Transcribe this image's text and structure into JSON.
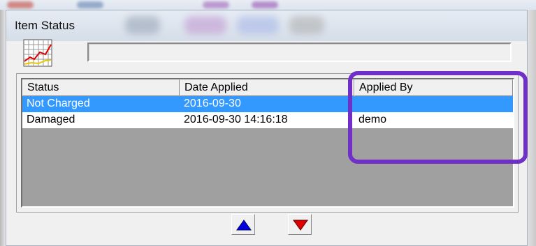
{
  "window": {
    "title": "Item Status"
  },
  "status_field": {
    "value": ""
  },
  "list": {
    "columns": [
      {
        "label": "Status"
      },
      {
        "label": "Date Applied"
      },
      {
        "label": "Applied By"
      }
    ],
    "rows": [
      {
        "status": "Not Charged",
        "date_applied": "2016-09-30",
        "applied_by": "",
        "selected": true
      },
      {
        "status": "Damaged",
        "date_applied": "2016-09-30 14:16:18",
        "applied_by": "demo",
        "selected": false
      }
    ]
  },
  "buttons": {
    "move_up_icon": "blue-up-triangle",
    "move_down_icon": "red-down-triangle"
  },
  "colors": {
    "selection": "#3399ff",
    "highlight_annotation": "#7030c8",
    "up_arrow": "#0000e0",
    "down_arrow": "#e00000"
  },
  "icons": {
    "chart": "line-chart-icon"
  }
}
